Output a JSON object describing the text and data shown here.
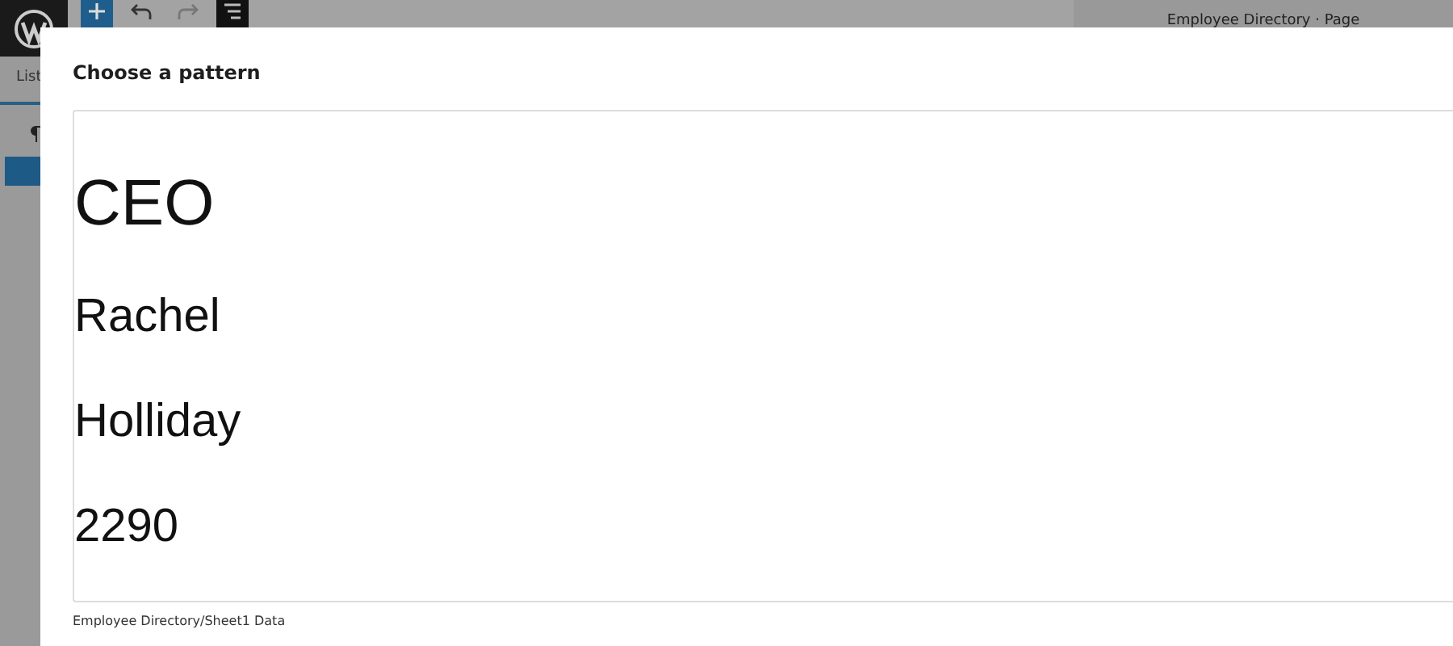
{
  "editor": {
    "document_title": "Employee Directory · Page",
    "sidebar_tab": "List"
  },
  "modal": {
    "title": "Choose a pattern",
    "preview_lines": [
      {
        "text": "CEO",
        "kind": "heading"
      },
      {
        "text": "Rachel",
        "kind": "line"
      },
      {
        "text": "Holliday",
        "kind": "line"
      },
      {
        "text": "2290",
        "kind": "line"
      }
    ],
    "caption": "Employee Directory/Sheet1 Data"
  }
}
